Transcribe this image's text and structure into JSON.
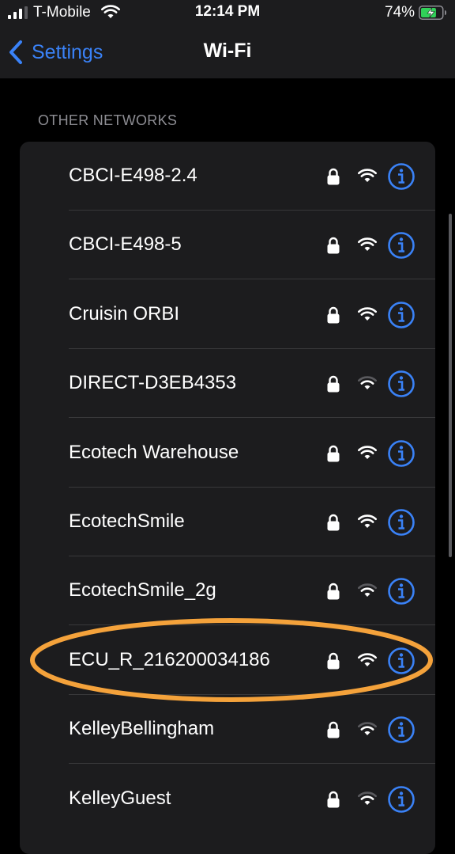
{
  "status_bar": {
    "carrier": "T-Mobile",
    "time": "12:14 PM",
    "battery_percent": "74%",
    "battery_level": 0.74,
    "battery_charging": true
  },
  "nav": {
    "back_label": "Settings",
    "title": "Wi-Fi"
  },
  "section": {
    "header": "OTHER NETWORKS"
  },
  "networks": [
    {
      "name": "CBCI-E498-2.4",
      "secured": true,
      "signal_bars": 3
    },
    {
      "name": "CBCI-E498-5",
      "secured": true,
      "signal_bars": 3
    },
    {
      "name": "Cruisin ORBI",
      "secured": true,
      "signal_bars": 3
    },
    {
      "name": "DIRECT-D3EB4353",
      "secured": true,
      "signal_bars": 2
    },
    {
      "name": "Ecotech Warehouse",
      "secured": true,
      "signal_bars": 3
    },
    {
      "name": "EcotechSmile",
      "secured": true,
      "signal_bars": 3
    },
    {
      "name": "EcotechSmile_2g",
      "secured": true,
      "signal_bars": 2
    },
    {
      "name": "ECU_R_216200034186",
      "secured": true,
      "signal_bars": 3,
      "highlighted": true
    },
    {
      "name": "KelleyBellingham",
      "secured": true,
      "signal_bars": 2
    },
    {
      "name": "KelleyGuest",
      "secured": true,
      "signal_bars": 2
    }
  ],
  "colors": {
    "accent": "#3a82f7",
    "highlight_ring": "#f4a23b",
    "battery_green": "#30d158",
    "background": "#000000",
    "cell_background": "#1c1c1e"
  },
  "icons": {
    "lock": "lock-icon",
    "wifi": "wifi-signal-icon",
    "info": "info-icon",
    "back": "chevron-left-icon"
  }
}
